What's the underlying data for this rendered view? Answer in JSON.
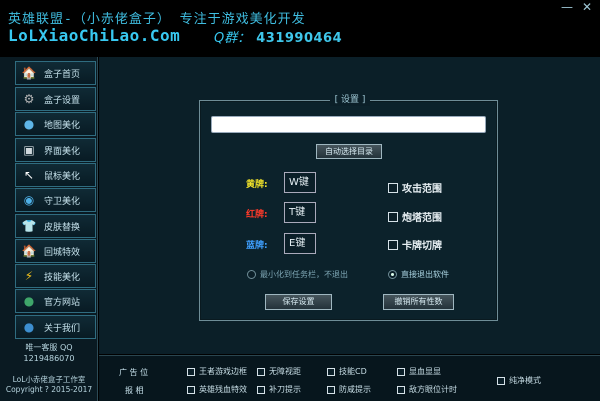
{
  "header": {
    "title_line": "英雄联盟-（小赤佬盒子） 专注于游戏美化开发",
    "site": "LoLXiaoChiLao.Com",
    "qq_label": "Q群：",
    "qq_number": "431990464",
    "min_glyph": "—",
    "close_glyph": "✕"
  },
  "sidebar": {
    "items": [
      {
        "label": "盒子首页",
        "icon": "home-icon",
        "glyph": "🏠",
        "color": "#d9b06a"
      },
      {
        "label": "盒子设置",
        "icon": "gear-icon",
        "glyph": "⚙",
        "color": "#b8b8b8"
      },
      {
        "label": "地图美化",
        "icon": "map-icon",
        "glyph": "●",
        "color": "#5fb6e8"
      },
      {
        "label": "界面美化",
        "icon": "window-icon",
        "glyph": "▣",
        "color": "#cfd8dc"
      },
      {
        "label": "鼠标美化",
        "icon": "cursor-icon",
        "glyph": "↖",
        "color": "#ffffff"
      },
      {
        "label": "守卫美化",
        "icon": "ward-icon",
        "glyph": "◉",
        "color": "#4fb0e6"
      },
      {
        "label": "皮肤替换",
        "icon": "shirt-icon",
        "glyph": "👕",
        "color": "#e6eef2"
      },
      {
        "label": "回城特效",
        "icon": "recall-icon",
        "glyph": "🏠",
        "color": "#c8a060"
      },
      {
        "label": "技能美化",
        "icon": "lightning-icon",
        "glyph": "⚡",
        "color": "#f4c21a"
      },
      {
        "label": "官方网站",
        "icon": "globe-icon",
        "glyph": "●",
        "color": "#3fa66a"
      },
      {
        "label": "关于我们",
        "icon": "info-icon",
        "glyph": "●",
        "color": "#3d8fd0"
      }
    ],
    "contact_label": "唯一客服 QQ",
    "contact_qq": "1219486070",
    "studio": "LoL小赤佬盒子工作室",
    "copyright": "Copyright ? 2015-2017"
  },
  "settings": {
    "title": "[ 设置 ]",
    "path_value": "",
    "dir_button": "自动选择目录",
    "keys": [
      {
        "label": "黄牌:",
        "value": "W键",
        "color": "#f0e22a"
      },
      {
        "label": "红牌:",
        "value": "T键",
        "color": "#ff3a2a"
      },
      {
        "label": "蓝牌:",
        "value": "E键",
        "color": "#3fa0ff"
      }
    ],
    "options": [
      {
        "label": "攻击范围",
        "checked": false
      },
      {
        "label": "炮塔范围",
        "checked": false
      },
      {
        "label": "卡牌切牌",
        "checked": false
      }
    ],
    "radio_minimize": "最小化到任务栏，不退出",
    "radio_exit": "直接退出软件",
    "radio_selected": "exit",
    "save_button": "保存设置",
    "cancel_button": "撤销所有性数"
  },
  "adbar": {
    "label_ad": "广  告  位",
    "label_report": "报  相",
    "checkboxes": [
      "王者游戏边框",
      "无障视距",
      "技能CD",
      "显血显显",
      "英雄残血特效",
      "补刀提示",
      "防咸提示",
      "敌方眼位计时",
      "纯净模式"
    ]
  }
}
